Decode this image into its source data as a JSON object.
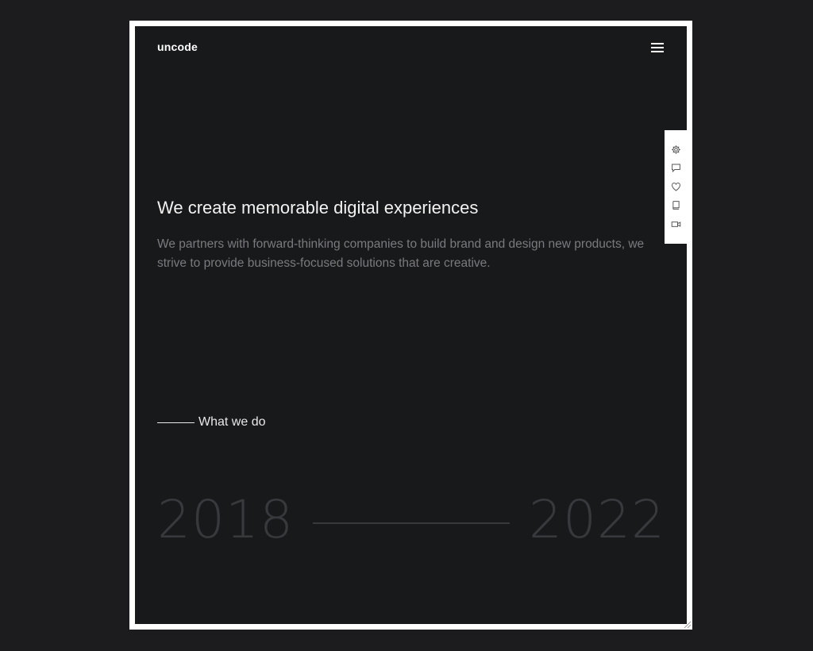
{
  "header": {
    "logo": "uncode",
    "menu_icon": "hamburger-menu-icon"
  },
  "hero": {
    "title": "We create memorable digital experiences",
    "description": "We partners with forward-thinking companies to build brand and design new products, we strive to provide business-focused solutions that are creative."
  },
  "section": {
    "label": "What we do"
  },
  "timeline": {
    "start_year": "2018",
    "end_year": "2022"
  },
  "side_toolbar": {
    "items": [
      {
        "icon": "settings-gear-icon"
      },
      {
        "icon": "comment-icon"
      },
      {
        "icon": "heart-icon"
      },
      {
        "icon": "book-icon"
      },
      {
        "icon": "video-camera-icon"
      }
    ]
  },
  "colors": {
    "background": "#1c1c1e",
    "frame_border": "#ffffff",
    "content_bg": "#18191b",
    "title_text": "#f2f2f2",
    "muted_text": "#7a7b7e",
    "year_text": "#38393c"
  }
}
